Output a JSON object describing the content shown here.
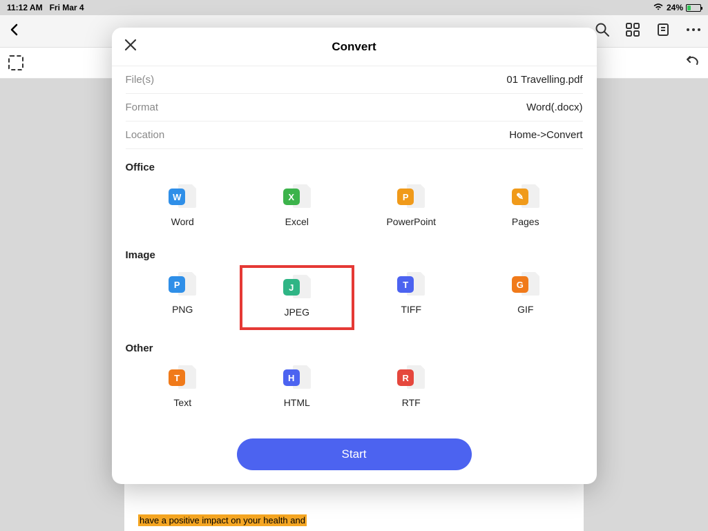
{
  "status": {
    "time": "11:12 AM",
    "date": "Fri Mar 4",
    "battery_pct": "24%"
  },
  "modal": {
    "title": "Convert",
    "rows": {
      "files_label": "File(s)",
      "files_value": "01 Travelling.pdf",
      "format_label": "Format",
      "format_value": "Word(.docx)",
      "location_label": "Location",
      "location_value": "Home->Convert"
    },
    "sections": {
      "office": "Office",
      "image": "Image",
      "other": "Other"
    },
    "formats": {
      "office": [
        {
          "label": "Word",
          "letter": "W",
          "color": "#2f8fe8"
        },
        {
          "label": "Excel",
          "letter": "X",
          "color": "#3cb34b"
        },
        {
          "label": "PowerPoint",
          "letter": "P",
          "color": "#f09a1a"
        },
        {
          "label": "Pages",
          "letter": "✎",
          "color": "#f09a1a"
        }
      ],
      "image": [
        {
          "label": "PNG",
          "letter": "P",
          "color": "#2f8fe8"
        },
        {
          "label": "JPEG",
          "letter": "J",
          "color": "#2fb585",
          "highlight": true
        },
        {
          "label": "TIFF",
          "letter": "T",
          "color": "#4c63f0"
        },
        {
          "label": "GIF",
          "letter": "G",
          "color": "#f07a1a"
        }
      ],
      "other": [
        {
          "label": "Text",
          "letter": "T",
          "color": "#f07a1a"
        },
        {
          "label": "HTML",
          "letter": "H",
          "color": "#4c63f0"
        },
        {
          "label": "RTF",
          "letter": "R",
          "color": "#e5473d"
        }
      ]
    },
    "start_label": "Start"
  },
  "background_text": "have a positive impact on your health and"
}
